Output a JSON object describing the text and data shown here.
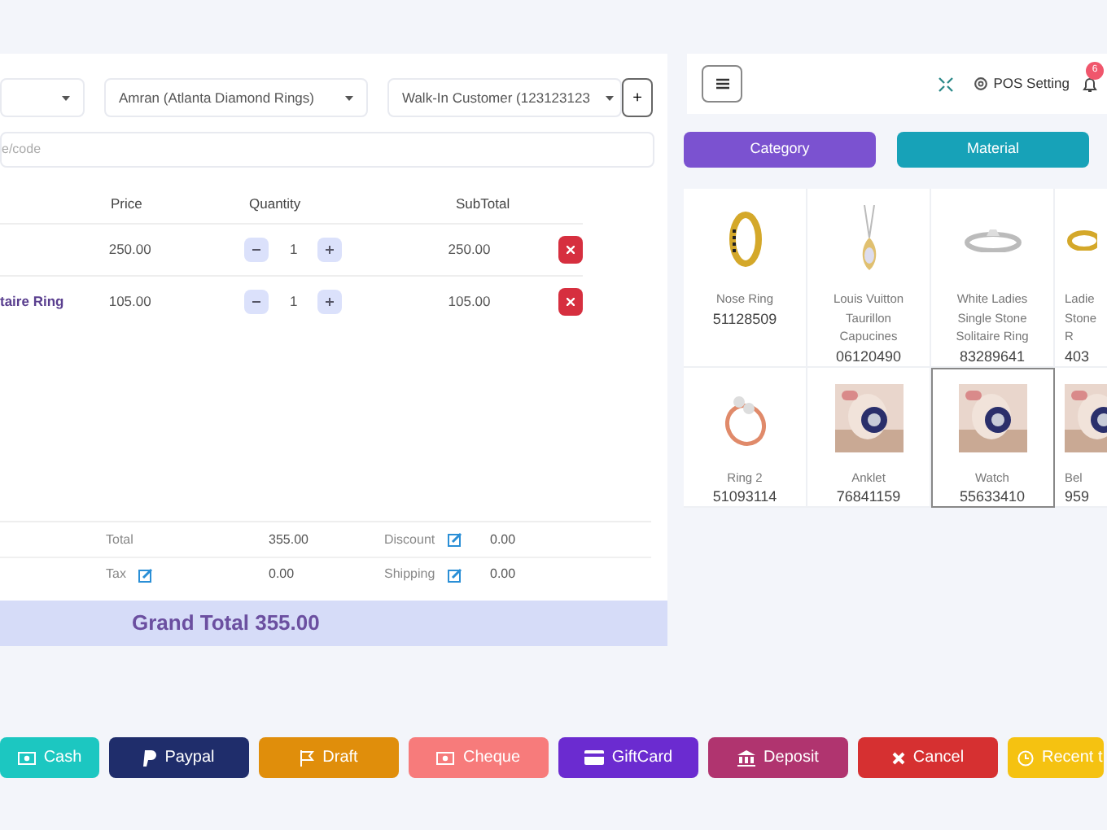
{
  "selects": [
    {
      "value": "Amran (Atlanta Diamond Rings)"
    },
    {
      "value": "Walk-In Customer (123123123"
    }
  ],
  "add_customer": "+",
  "search": {
    "placeholder": "e/code"
  },
  "cart": {
    "columns": [
      "",
      "Price",
      "Quantity",
      "SubTotal"
    ],
    "rows": [
      {
        "name": "",
        "price": "250.00",
        "qty": "1",
        "subtotal": "250.00"
      },
      {
        "name": "taire Ring",
        "price": "105.00",
        "qty": "1",
        "subtotal": "105.00"
      }
    ]
  },
  "totals": [
    {
      "label": "Total",
      "value": "355.00",
      "editable": false
    },
    {
      "label": "Discount",
      "value": "0.00",
      "editable": true
    },
    {
      "label": "Tax",
      "value": "0.00",
      "editable": true
    },
    {
      "label": "Shipping",
      "value": "0.00",
      "editable": true
    }
  ],
  "grand_total": "Grand Total 355.00",
  "header": {
    "setting": "POS Setting",
    "notifications": "6"
  },
  "filters": [
    {
      "label": "Category",
      "color": "#7b52d0"
    },
    {
      "label": "Material",
      "color": "#17a2b8"
    }
  ],
  "products": [
    {
      "kind": "hoop",
      "lines": [
        "Nose Ring"
      ],
      "code": "51128509",
      "selected": false
    },
    {
      "kind": "pendant",
      "lines": [
        "Louis Vuitton",
        "Taurillon",
        "Capucines"
      ],
      "code": "06120490",
      "selected": false
    },
    {
      "kind": "silver-ring",
      "lines": [
        "White Ladies",
        "Single Stone",
        "Solitaire Ring"
      ],
      "code": "83289641",
      "selected": false
    },
    {
      "kind": "gold-ring",
      "lines": [
        "Ladie",
        "Stone",
        "R"
      ],
      "code": "403",
      "selected": false
    },
    {
      "kind": "rose-ring",
      "lines": [
        "Ring 2"
      ],
      "code": "51093114",
      "selected": false
    },
    {
      "lines": [
        "Anklet"
      ],
      "code": "76841159",
      "selected": false
    },
    {
      "lines": [
        "Watch"
      ],
      "code": "55633410",
      "selected": true
    },
    {
      "lines": [
        "Bel"
      ],
      "code": "959",
      "selected": false
    }
  ],
  "actions": [
    {
      "kind": "cash",
      "label": "Cash",
      "color": "#1cc7c1"
    },
    {
      "kind": "paypal",
      "label": "Paypal",
      "color": "#1f2d6b"
    },
    {
      "kind": "draft",
      "label": "Draft",
      "color": "#e08e0b"
    },
    {
      "kind": "cheque",
      "label": "Cheque",
      "color": "#f77b7b"
    },
    {
      "kind": "giftcard",
      "label": "GiftCard",
      "color": "#6b2bd0"
    },
    {
      "kind": "deposit",
      "label": "Deposit",
      "color": "#b0346f"
    },
    {
      "kind": "cancel",
      "label": "Cancel",
      "color": "#d63031"
    },
    {
      "kind": "recent",
      "label": "Recent t",
      "color": "#f5c211"
    }
  ]
}
